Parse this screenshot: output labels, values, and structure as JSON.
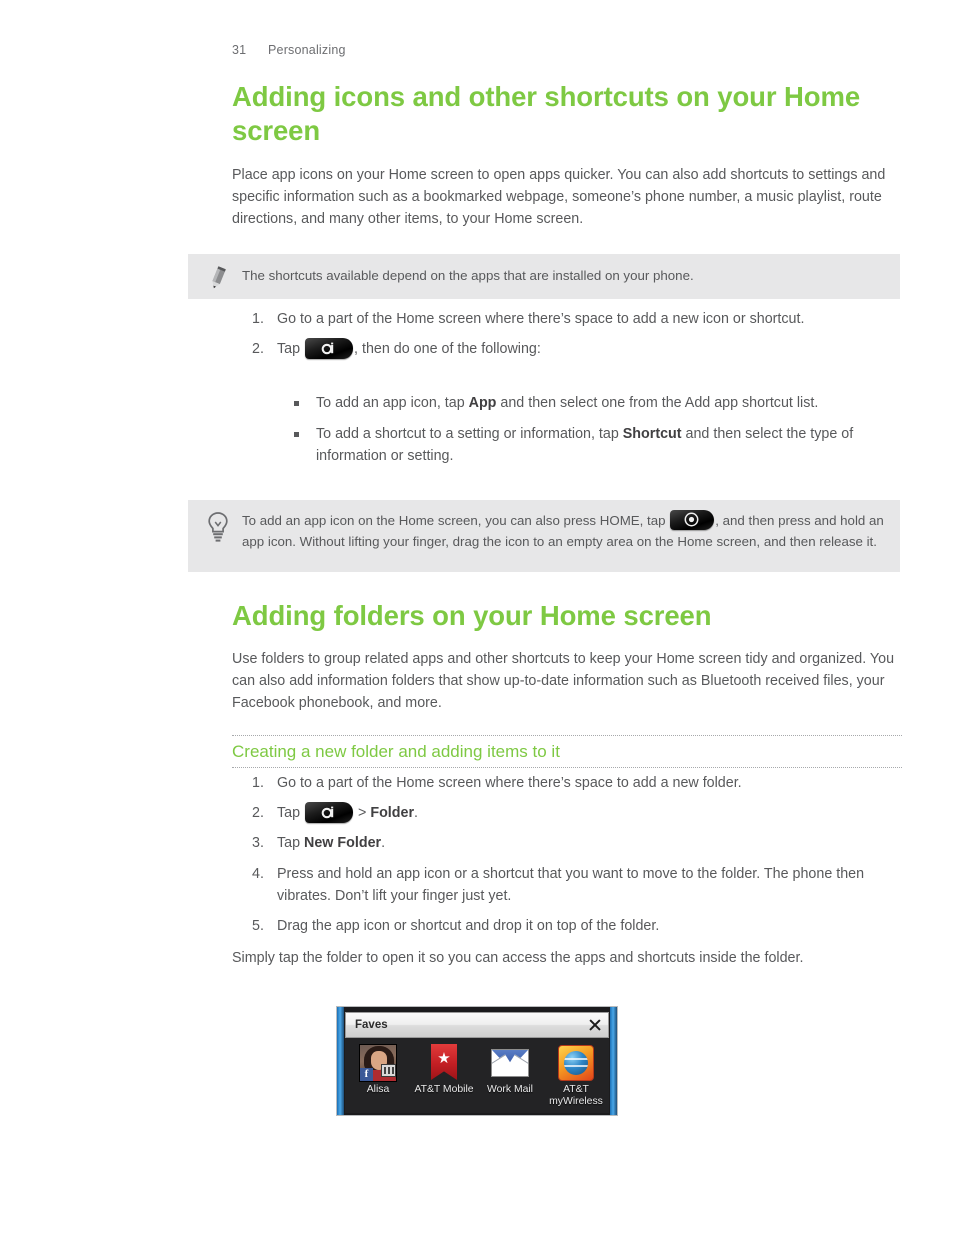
{
  "header": {
    "page_number": "31",
    "chapter": "Personalizing"
  },
  "colors": {
    "heading_green": "#7ec943",
    "body_text": "#58595b",
    "callout_background": "#e7e7e8"
  },
  "section1": {
    "title": "Adding icons and other shortcuts on your Home screen",
    "intro": "Place app icons on your Home screen to open apps quicker. You can also add shortcuts to settings and specific information such as a bookmarked webpage, someone’s phone number, a music playlist, route directions, and many other items, to your Home screen.",
    "note": {
      "icon": "pencil-icon",
      "text": "The shortcuts available depend on the apps that are installed on your phone."
    },
    "steps": [
      {
        "number": "1.",
        "text": "Go to a part of the Home screen where there’s space to add a new icon or shortcut."
      },
      {
        "number": "2.",
        "prefix": "Tap",
        "icon": "personalize-key-icon",
        "suffix": ", then do one of the following:"
      }
    ],
    "sub_bullets": [
      {
        "prefix": "To add an app icon, tap ",
        "bold": "App",
        "suffix": " and then select one from the Add app shortcut list."
      },
      {
        "prefix": "To add a shortcut to a setting or information, tap ",
        "bold": "Shortcut",
        "suffix": " and then select the type of information or setting."
      }
    ],
    "tip": {
      "icon": "lightbulb-icon",
      "text_before": "To add an app icon on the Home screen, you can also press HOME, tap",
      "inline_icon": "all-apps-key-icon",
      "text_after": ", and then press and hold an app icon. Without lifting your finger, drag the icon to an empty area on the Home screen, and then release it."
    }
  },
  "section2": {
    "title": "Adding folders on your Home screen",
    "intro": "Use folders to group related apps and other shortcuts to keep your Home screen tidy and organized. You can also add information folders that show up-to-date information such as Bluetooth received files, your Facebook phonebook, and more.",
    "subsection_title": "Creating a new folder and adding items to it",
    "steps": [
      {
        "number": "1.",
        "text": "Go to a part of the Home screen where there’s space to add a new folder."
      },
      {
        "number": "2.",
        "prefix": "Tap",
        "icon": "personalize-key-icon",
        "middle": " > ",
        "bold": "Folder",
        "suffix": "."
      },
      {
        "number": "3.",
        "prefix": "Tap ",
        "bold": "New Folder",
        "suffix": "."
      },
      {
        "number": "4.",
        "text": "Press and hold an app icon or a shortcut that you want to move to the folder. The phone then vibrates. Don’t lift your finger just yet."
      },
      {
        "number": "5.",
        "text": "Drag the app icon or shortcut and drop it on top of the folder."
      }
    ],
    "closing": "Simply tap the folder to open it so you can access the apps and shortcuts inside the folder."
  },
  "screenshot": {
    "folder_title": "Faves",
    "close_icon": "close-icon",
    "apps": [
      {
        "label": "Alisa",
        "icon": "contact-photo-icon"
      },
      {
        "label": "AT&T Mobile",
        "icon": "bookmark-star-icon"
      },
      {
        "label": "Work Mail",
        "icon": "envelope-icon"
      },
      {
        "label": "AT&T myWireless",
        "icon": "att-globe-icon"
      }
    ]
  }
}
